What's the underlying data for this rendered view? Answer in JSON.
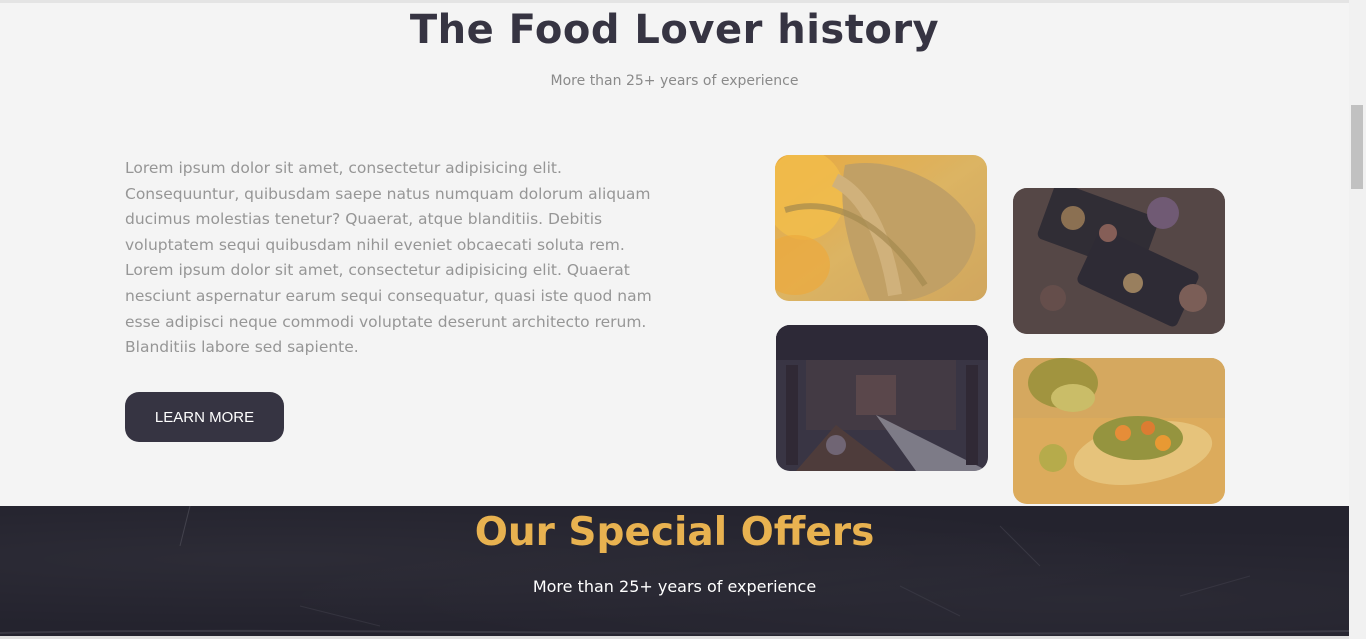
{
  "history": {
    "title": "The Food Lover history",
    "subtitle": "More than 25+ years of experience",
    "paragraph_1": "Lorem ipsum dolor sit amet, consectetur adipisicing elit. Consequuntur, quibusdam saepe natus numquam dolorum aliquam ducimus molestias tenetur? Quaerat, atque blanditiis. Debitis voluptatem sequi quibusdam nihil eveniet obcaecati soluta rem.",
    "paragraph_2": "Lorem ipsum dolor sit amet, consectetur adipisicing elit. Quaerat nesciunt aspernatur earum sequi consequatur, quasi iste quod nam esse adipisci neque commodi voluptate deserunt architecto rerum. Blanditiis labore sed sapiente.",
    "button_label": "LEARN MORE"
  },
  "offers": {
    "title": "Our Special Offers",
    "subtitle": "More than 25+ years of experience"
  },
  "colors": {
    "dark": "#363442",
    "accent": "#e8b250",
    "section_bg": "#f4f4f4",
    "offers_bg": "#24232e"
  }
}
